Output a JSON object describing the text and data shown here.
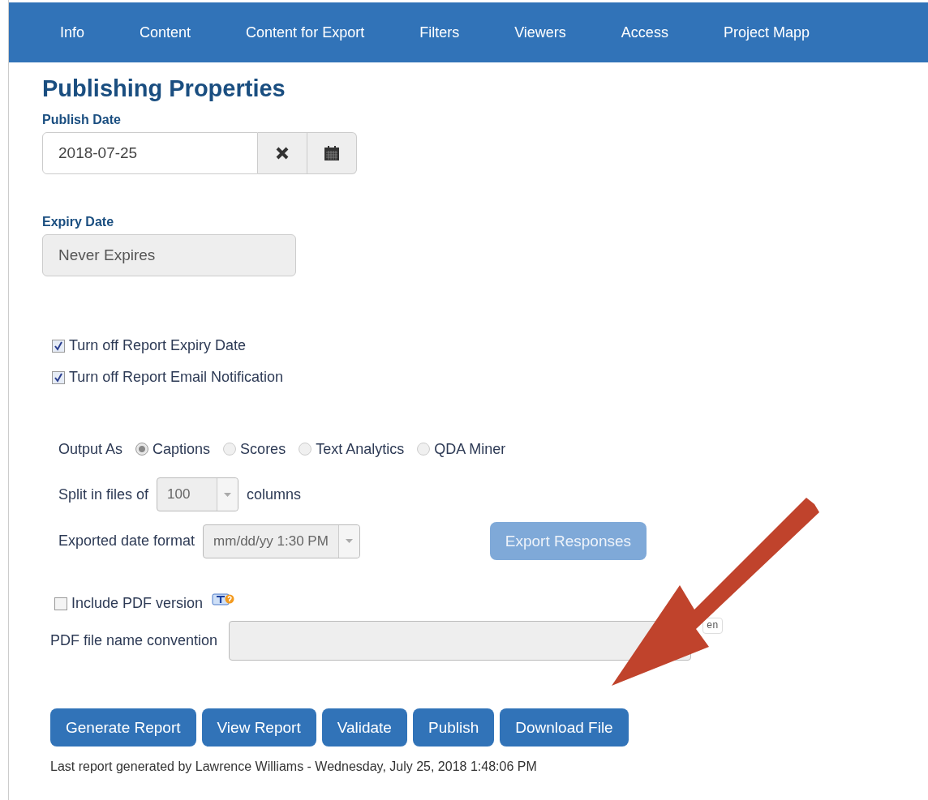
{
  "tabs": [
    {
      "label": "Info"
    },
    {
      "label": "Content"
    },
    {
      "label": "Content for Export"
    },
    {
      "label": "Filters"
    },
    {
      "label": "Viewers"
    },
    {
      "label": "Access"
    },
    {
      "label": "Project Mapp"
    }
  ],
  "title": "Publishing Properties",
  "publish_date": {
    "label": "Publish Date",
    "value": "2018-07-25"
  },
  "expiry_date": {
    "label": "Expiry Date",
    "value": "Never Expires",
    "disabled": true
  },
  "checkboxes": [
    {
      "label": "Turn off Report Expiry Date",
      "checked": true
    },
    {
      "label": "Turn off Report Email Notification",
      "checked": true
    }
  ],
  "output_as": {
    "label": "Output As",
    "options": [
      {
        "label": "Captions",
        "selected": true
      },
      {
        "label": "Scores",
        "selected": false
      },
      {
        "label": "Text Analytics",
        "selected": false
      },
      {
        "label": "QDA Miner",
        "selected": false
      }
    ]
  },
  "split": {
    "label": "Split in files of",
    "value": "100",
    "suffix": "columns"
  },
  "date_format": {
    "label": "Exported date format",
    "value": "mm/dd/yy 1:30 PM"
  },
  "export_button": {
    "label": "Export Responses",
    "disabled": true
  },
  "include_pdf": {
    "label": "Include PDF version",
    "checked": false
  },
  "pdf_name": {
    "label": "PDF file name convention",
    "language": "en"
  },
  "buttons": [
    {
      "label": "Generate Report"
    },
    {
      "label": "View Report"
    },
    {
      "label": "Validate"
    },
    {
      "label": "Publish"
    },
    {
      "label": "Download File"
    }
  ],
  "footer": "Last report generated by Lawrence Williams - Wednesday, July 25, 2018 1:48:06 PM"
}
